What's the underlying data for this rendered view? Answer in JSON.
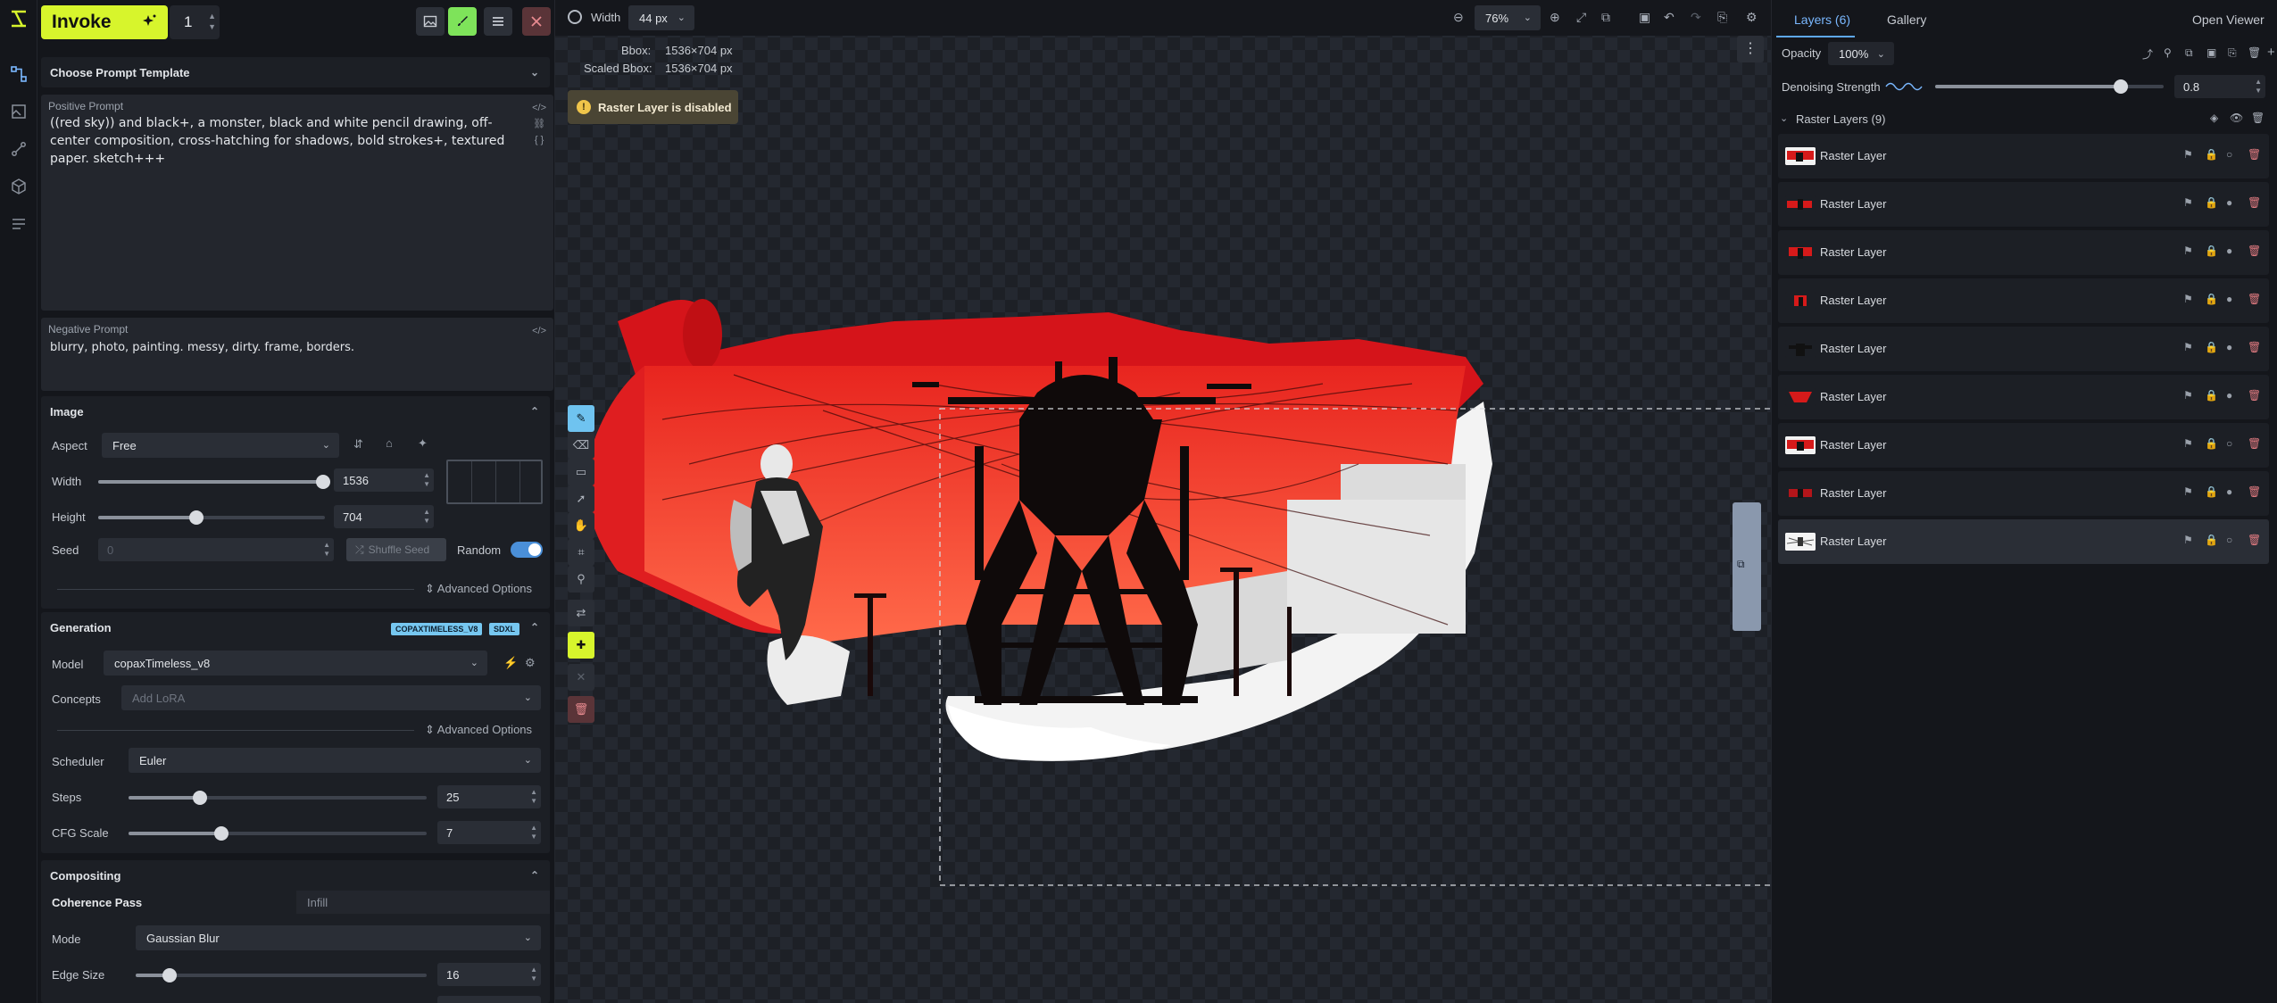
{
  "app": {
    "invoke_label": "Invoke",
    "quantity": "1"
  },
  "left": {
    "template_header": "Choose Prompt Template",
    "positive_label": "Positive Prompt",
    "positive_text": "((red sky)) and black+, a monster, black and white pencil drawing, off-center composition, cross-hatching for shadows, bold strokes+, textured paper. sketch+++",
    "negative_label": "Negative Prompt",
    "negative_text": "blurry, photo, painting. messy, dirty. frame, borders.",
    "image": {
      "header": "Image",
      "aspect_label": "Aspect",
      "aspect_value": "Free",
      "width_label": "Width",
      "width_value": "1536",
      "height_label": "Height",
      "height_value": "704",
      "seed_label": "Seed",
      "seed_value": "0",
      "shuffle_label": "Shuffle Seed",
      "random_label": "Random",
      "advanced_label": "Advanced Options"
    },
    "generation": {
      "header": "Generation",
      "tag_model": "COPAXTIMELESS_V8",
      "tag_base": "SDXL",
      "model_label": "Model",
      "model_value": "copaxTimeless_v8",
      "concepts_label": "Concepts",
      "concepts_placeholder": "Add LoRA",
      "advanced_label": "Advanced Options",
      "scheduler_label": "Scheduler",
      "scheduler_value": "Euler",
      "steps_label": "Steps",
      "steps_value": "25",
      "cfg_label": "CFG Scale",
      "cfg_value": "7"
    },
    "compositing": {
      "header": "Compositing",
      "tab_coherence": "Coherence Pass",
      "tab_infill": "Infill",
      "mode_label": "Mode",
      "mode_value": "Gaussian Blur",
      "edge_label": "Edge Size",
      "edge_value": "16"
    }
  },
  "canvas": {
    "width_label": "Width",
    "width_value": "44 px",
    "zoom_value": "76%",
    "bbox_label": "Bbox:",
    "bbox_value": "1536×704 px",
    "scaled_label": "Scaled Bbox:",
    "scaled_value": "1536×704 px",
    "toast_text": "Raster Layer is disabled"
  },
  "right": {
    "tab_layers": "Layers (6)",
    "tab_gallery": "Gallery",
    "open_viewer": "Open Viewer",
    "opacity_label": "Opacity",
    "opacity_value": "100%",
    "denoise_label": "Denoising Strength",
    "denoise_value": "0.8",
    "group_label": "Raster Layers (9)",
    "layers": [
      {
        "name": "Raster Layer"
      },
      {
        "name": "Raster Layer"
      },
      {
        "name": "Raster Layer"
      },
      {
        "name": "Raster Layer"
      },
      {
        "name": "Raster Layer"
      },
      {
        "name": "Raster Layer"
      },
      {
        "name": "Raster Layer"
      },
      {
        "name": "Raster Layer"
      },
      {
        "name": "Raster Layer"
      }
    ]
  },
  "colors": {
    "accent": "#d7f52c",
    "link_blue": "#7ab8ff",
    "danger": "#e07a80"
  }
}
